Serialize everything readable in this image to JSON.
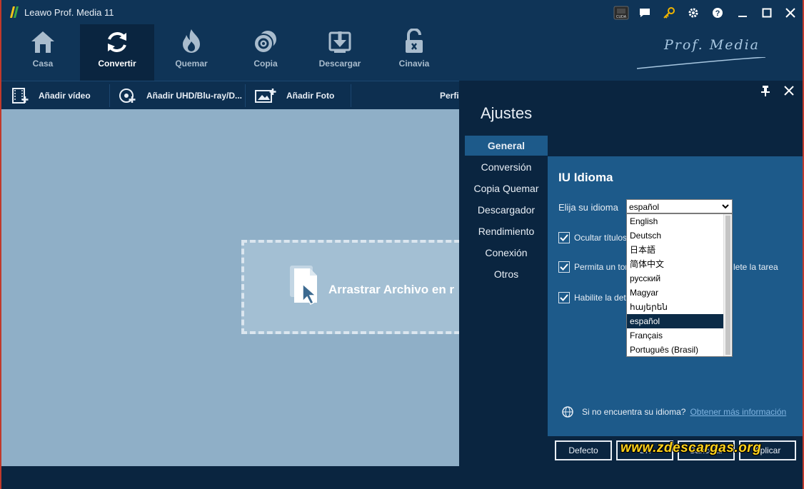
{
  "app": {
    "title": "Leawo Prof. Media 11",
    "brand": "Prof. Media"
  },
  "titlebar": {
    "cuda_label": "CUDA"
  },
  "nav": {
    "items": [
      {
        "label": "Casa",
        "icon": "home-icon"
      },
      {
        "label": "Convertir",
        "icon": "convert-icon",
        "active": true
      },
      {
        "label": "Quemar",
        "icon": "burn-icon"
      },
      {
        "label": "Copia",
        "icon": "copy-icon"
      },
      {
        "label": "Descargar",
        "icon": "download-icon"
      },
      {
        "label": "Cinavia",
        "icon": "cinavia-icon"
      }
    ]
  },
  "toolbar": {
    "add_video": "Añadir vídeo",
    "add_uhd": "Añadir UHD/Blu-ray/D...",
    "add_photo": "Añadir Foto",
    "profile": "Perfi"
  },
  "workspace": {
    "drop_label": "Arrastrar Archivo en r"
  },
  "settings": {
    "title": "Ajustes",
    "sidebar": [
      {
        "label": "General",
        "active": true
      },
      {
        "label": "Conversión"
      },
      {
        "label": "Copia  Quemar"
      },
      {
        "label": "Descargador"
      },
      {
        "label": "Rendimiento"
      },
      {
        "label": "Conexión"
      },
      {
        "label": "Otros"
      }
    ],
    "section_title": "IU Idioma",
    "language_label": "Elija su idioma",
    "language_selected": "español",
    "language_options": [
      "English",
      "Deutsch",
      "日本語",
      "简体中文",
      "русский",
      "Magyar",
      "հայերեն",
      "español",
      "Français",
      "Português (Brasil)"
    ],
    "checkboxes": [
      {
        "label": "Ocultar títulos",
        "checked": true
      },
      {
        "label": "Permita un tor",
        "tail": "lete la tarea",
        "checked": true
      },
      {
        "label": "Habilite la det",
        "checked": true
      }
    ],
    "help_question": "Si no encuentra su idioma?",
    "help_link": "Obtener más información",
    "buttons": {
      "default": "Defecto",
      "ok": "OK",
      "cancel": "Cancelar",
      "apply": "Aplicar"
    }
  },
  "watermark": "www.zdescargas.org",
  "colors": {
    "accent": "#1d5a8a",
    "nav_bg": "#0f3457",
    "work_bg": "#8fafc7",
    "watermark": "#ffd21a"
  }
}
